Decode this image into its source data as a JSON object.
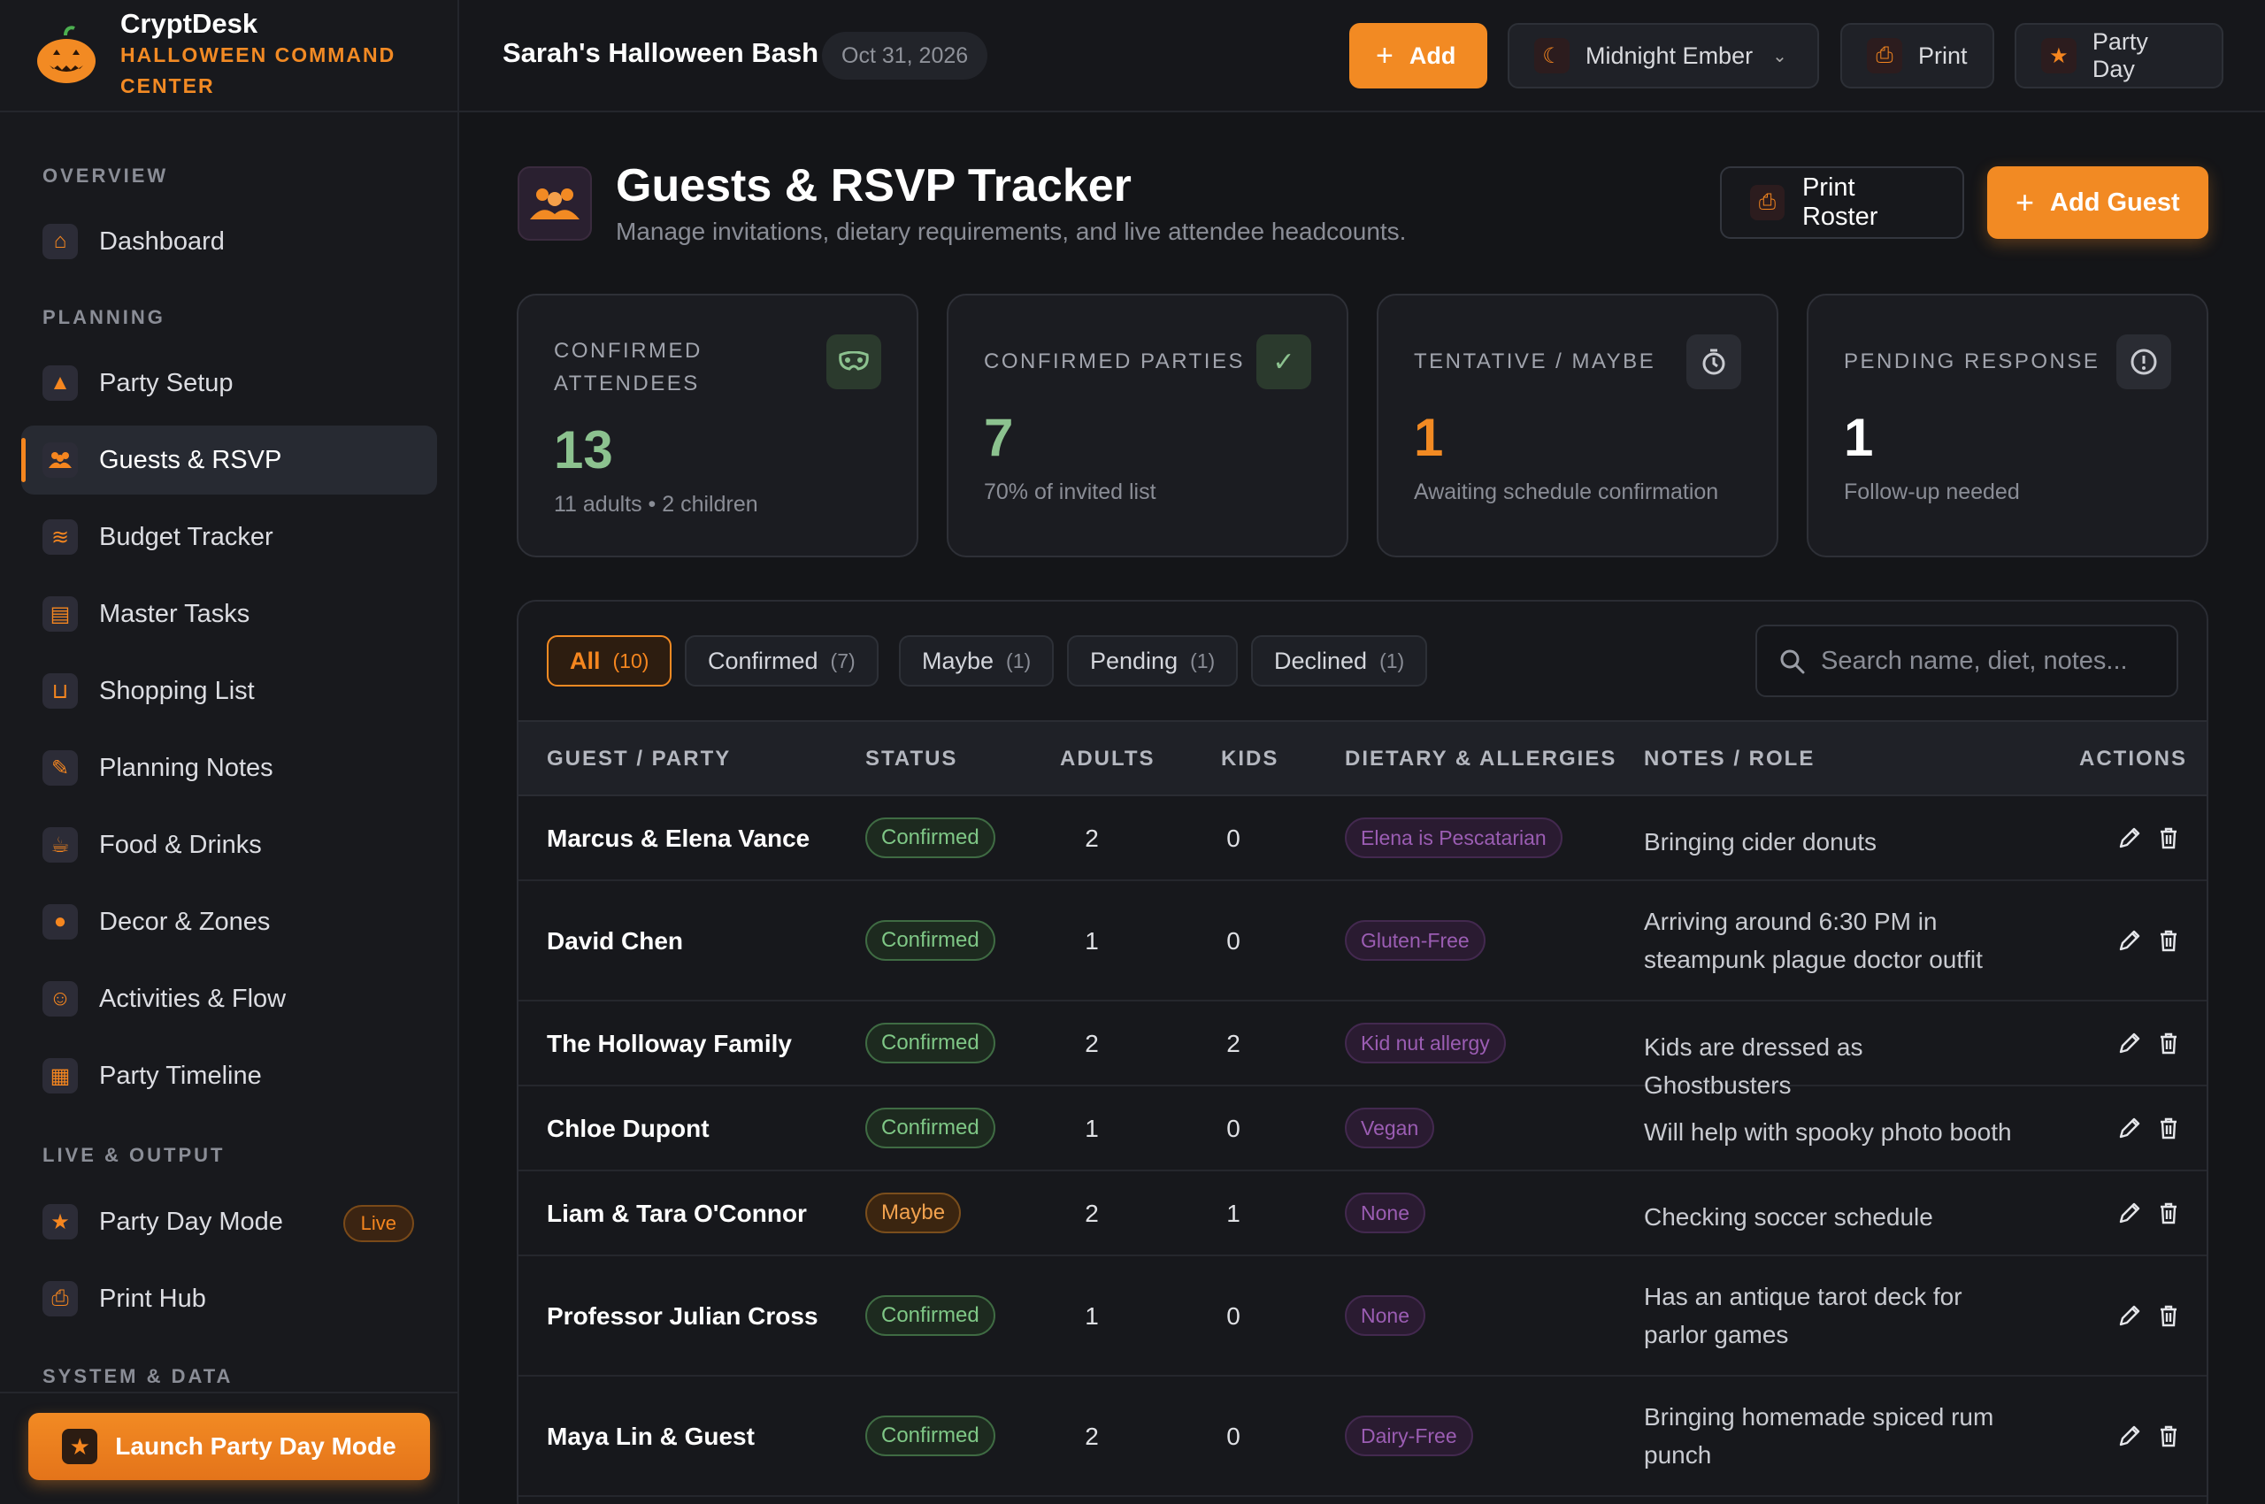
{
  "brand": {
    "name": "CryptDesk",
    "subtitle": "HALLOWEEN COMMAND CENTER"
  },
  "sidebar": {
    "sections": [
      {
        "label": "OVERVIEW"
      },
      {
        "label": "PLANNING"
      },
      {
        "label": "LIVE & OUTPUT"
      },
      {
        "label": "SYSTEM & DATA"
      }
    ],
    "items": [
      {
        "label": "Dashboard",
        "icon": "home-icon"
      },
      {
        "label": "Party Setup",
        "icon": "witch-hat-icon"
      },
      {
        "label": "Guests & RSVP",
        "icon": "people-icon",
        "active": true
      },
      {
        "label": "Budget Tracker",
        "icon": "coins-icon"
      },
      {
        "label": "Master Tasks",
        "icon": "clipboard-icon"
      },
      {
        "label": "Shopping List",
        "icon": "cart-icon"
      },
      {
        "label": "Planning Notes",
        "icon": "notepad-icon"
      },
      {
        "label": "Food & Drinks",
        "icon": "drink-icon"
      },
      {
        "label": "Decor & Zones",
        "icon": "pumpkin-icon"
      },
      {
        "label": "Activities & Flow",
        "icon": "masks-icon"
      },
      {
        "label": "Party Timeline",
        "icon": "calendar-icon"
      },
      {
        "label": "Party Day Mode",
        "icon": "star-icon",
        "badge": "Live"
      },
      {
        "label": "Print Hub",
        "icon": "printer-icon"
      }
    ],
    "launch_label": "Launch Party Day Mode"
  },
  "topbar": {
    "event_title": "Sarah's Halloween Bash",
    "event_date": "Oct 31, 2026",
    "add_label": "Add",
    "theme_label": "Midnight Ember",
    "print_label": "Print",
    "party_day_label": "Party Day"
  },
  "page": {
    "title": "Guests & RSVP Tracker",
    "subtitle": "Manage invitations, dietary requirements, and live attendee headcounts.",
    "print_roster_label": "Print Roster",
    "add_guest_label": "Add Guest"
  },
  "stats": [
    {
      "label": "CONFIRMED ATTENDEES",
      "value": "13",
      "sub": "11 adults • 2 children",
      "color": "#8cc28f",
      "icon": "mask-icon"
    },
    {
      "label": "CONFIRMED PARTIES",
      "value": "7",
      "sub": "70% of invited list",
      "color": "#8cc28f",
      "icon": "check-icon"
    },
    {
      "label": "TENTATIVE / MAYBE",
      "value": "1",
      "sub": "Awaiting schedule confirmation",
      "color": "#f28a23",
      "icon": "timer-icon"
    },
    {
      "label": "PENDING RESPONSE",
      "value": "1",
      "sub": "Follow-up needed",
      "color": "#ffffff",
      "icon": "alert-icon"
    }
  ],
  "filters": [
    {
      "label": "All",
      "count": "(10)",
      "active": true
    },
    {
      "label": "Confirmed",
      "count": "(7)"
    },
    {
      "label": "Maybe",
      "count": "(1)"
    },
    {
      "label": "Pending",
      "count": "(1)"
    },
    {
      "label": "Declined",
      "count": "(1)"
    }
  ],
  "search": {
    "placeholder": "Search name, diet, notes..."
  },
  "table": {
    "columns": [
      "GUEST / PARTY",
      "STATUS",
      "ADULTS",
      "KIDS",
      "DIETARY & ALLERGIES",
      "NOTES / ROLE",
      "ACTIONS"
    ],
    "rows": [
      {
        "name": "Marcus & Elena Vance",
        "status": "Confirmed",
        "adults": "2",
        "kids": "0",
        "diet": "Elena is Pescatarian",
        "notes": "Bringing cider donuts"
      },
      {
        "name": "David Chen",
        "status": "Confirmed",
        "adults": "1",
        "kids": "0",
        "diet": "Gluten-Free",
        "notes": "Arriving around 6:30 PM in steampunk plague doctor outfit"
      },
      {
        "name": "The Holloway Family",
        "status": "Confirmed",
        "adults": "2",
        "kids": "2",
        "diet": "Kid nut allergy",
        "notes": "Kids are dressed as Ghostbusters"
      },
      {
        "name": "Chloe Dupont",
        "status": "Confirmed",
        "adults": "1",
        "kids": "0",
        "diet": "Vegan",
        "notes": "Will help with spooky photo booth"
      },
      {
        "name": "Liam & Tara O'Connor",
        "status": "Maybe",
        "adults": "2",
        "kids": "1",
        "diet": "None",
        "notes": "Checking soccer schedule"
      },
      {
        "name": "Professor Julian Cross",
        "status": "Confirmed",
        "adults": "1",
        "kids": "0",
        "diet": "None",
        "notes": "Has an antique tarot deck for parlor games"
      },
      {
        "name": "Maya Lin & Guest",
        "status": "Confirmed",
        "adults": "2",
        "kids": "0",
        "diet": "Dairy-Free",
        "notes": "Bringing homemade spiced rum punch"
      }
    ]
  },
  "colors": {
    "accent": "#f28a23",
    "confirmed": "#7fc786",
    "maybe": "#f2a24e",
    "diet": "#9b5db3"
  }
}
